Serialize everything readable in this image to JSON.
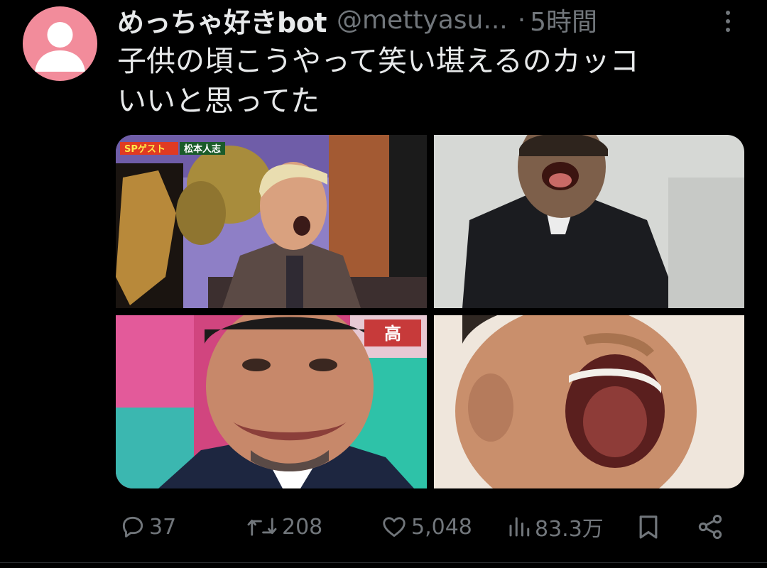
{
  "user": {
    "display_name": "めっちゃ好きbot",
    "handle": "@mettyasu...",
    "separator": "·",
    "time_ago": "5時間",
    "avatar_color": "#f28c9b"
  },
  "tweet": {
    "text_lines": [
      "子供の頃こうやって笑い堪えるのカッコ",
      "いいと思ってた"
    ],
    "images": [
      {
        "caption_left": "SPゲスト",
        "caption_right": "松本人志"
      },
      {},
      {
        "sign": "高"
      },
      {}
    ]
  },
  "actions": {
    "reply_count": "37",
    "retweet_count": "208",
    "like_count": "5,048",
    "view_count": "83.3万",
    "reply_icon": "reply-icon",
    "retweet_icon": "retweet-icon",
    "like_icon": "heart-icon",
    "views_icon": "bar-chart-icon",
    "bookmark_icon": "bookmark-icon",
    "share_icon": "share-icon"
  },
  "colors": {
    "background": "#000000",
    "text": "#e7e9ea",
    "muted": "#71767b"
  }
}
